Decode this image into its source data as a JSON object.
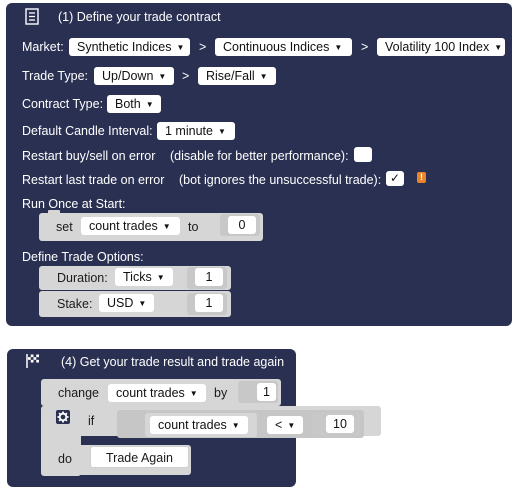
{
  "block1": {
    "title": "(1) Define your trade contract",
    "icon": "list-icon",
    "market_label": "Market:",
    "market": [
      "Synthetic Indices",
      "Continuous Indices",
      "Volatility 100 Index"
    ],
    "separator": ">",
    "trade_type_label": "Trade Type:",
    "trade_type": [
      "Up/Down",
      "Rise/Fall"
    ],
    "contract_type_label": "Contract Type:",
    "contract_type": "Both",
    "candle_label": "Default Candle Interval:",
    "candle": "1 minute",
    "restart_error_label": "Restart buy/sell on error",
    "restart_error_hint": "(disable for better performance):",
    "restart_error_checked": false,
    "restart_last_label": "Restart last trade on error",
    "restart_last_hint": "(bot ignores the unsuccessful trade):",
    "restart_last_checked": true,
    "check_mark": "✓",
    "warning_icon": "warning-icon",
    "warning_glyph": "!",
    "run_once_label": "Run Once at Start:",
    "set_label": "set",
    "set_var": "count trades",
    "to_label": "to",
    "set_value": "0",
    "define_options_label": "Define Trade Options:",
    "duration_label": "Duration:",
    "duration_unit": "Ticks",
    "duration_value": "1",
    "stake_label": "Stake:",
    "stake_currency": "USD",
    "stake_value": "1"
  },
  "block4": {
    "title": "(4) Get your trade result and trade again",
    "icon": "checkered-flag-icon",
    "change_label": "change",
    "change_var": "count trades",
    "by_label": "by",
    "by_value": "1",
    "if_label": "if",
    "gear_icon": "gear-icon",
    "cond_var": "count trades",
    "operator": "<",
    "cond_value": "10",
    "do_label": "do",
    "do_action": "Trade Again"
  },
  "colors": {
    "block_navy": "#2a3052",
    "block_gray": "#d6d6d6",
    "warning": "#e8852a"
  }
}
